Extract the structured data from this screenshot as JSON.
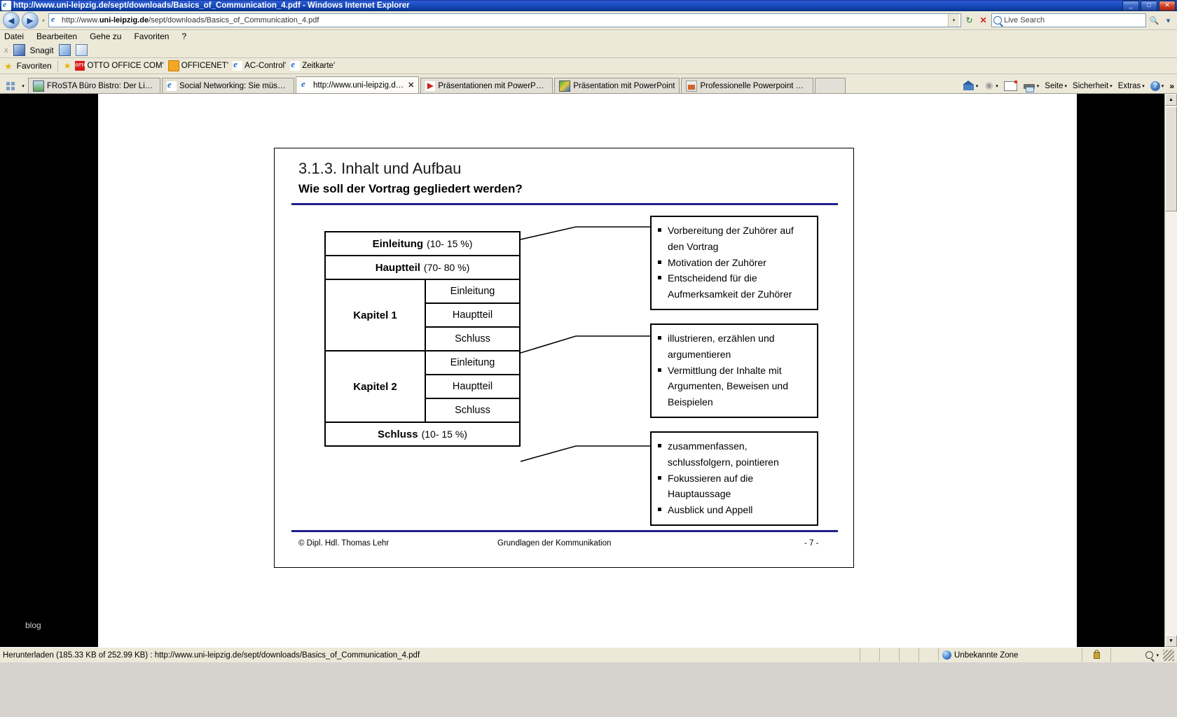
{
  "window": {
    "title": "http://www.uni-leipzig.de/sept/downloads/Basics_of_Communication_4.pdf - Windows Internet Explorer",
    "minimize_label": "_",
    "maximize_label": "□",
    "close_label": "✕",
    "app_icon": "ie-icon"
  },
  "address_bar": {
    "back_label": "◀",
    "forward_label": "▶",
    "history_caret": "▾",
    "url_prefix": "http://www.",
    "url_host": "uni-leipzig.de",
    "url_suffix": "/sept/downloads/Basics_of_Communication_4.pdf",
    "url_full": "http://www.uni-leipzig.de/sept/downloads/Basics_of_Communication_4.pdf",
    "dropdown_label": "▾",
    "refresh_label": "↻",
    "stop_label": "✕",
    "search_placeholder": "Live Search",
    "search_go_label": "🔍",
    "search_caret": "▾"
  },
  "menu": {
    "items": [
      "Datei",
      "Bearbeiten",
      "Gehe zu",
      "Favoriten",
      "?"
    ]
  },
  "snagit_toolbar": {
    "close_label": "x",
    "app_label": "Snagit"
  },
  "favorites_bar": {
    "label": "Favoriten",
    "items": [
      {
        "label": "OTTO OFFICE COM'",
        "icon": "otto-icon"
      },
      {
        "label": "OFFICENET'",
        "icon": "officenet-icon"
      },
      {
        "label": "AC-Control'",
        "icon": "ie-icon"
      },
      {
        "label": "Zeitkarte'",
        "icon": "ie-icon"
      }
    ]
  },
  "tabs": [
    {
      "label": "FRoSTA Büro Bistro: Der Lief…",
      "icon": "frosta-icon",
      "active": false
    },
    {
      "label": "Social Networking: Sie müsse…",
      "icon": "ie-icon",
      "active": false
    },
    {
      "label": "http://www.uni-leipzig.d…",
      "icon": "ie-icon",
      "active": true,
      "close_label": "✕"
    },
    {
      "label": "Präsentationen mit PowerPoi…",
      "icon": "play-icon",
      "active": false
    },
    {
      "label": "Präsentation mit PowerPoint",
      "icon": "colorful-icon",
      "active": false
    },
    {
      "label": "Professionelle Powerpoint Pr…",
      "icon": "powerpoint-icon",
      "active": false
    }
  ],
  "tab_tools": {
    "home_label": "",
    "home_caret": "▾",
    "feeds_label": "",
    "feeds_caret": "▾",
    "mail_label": "",
    "print_label": "",
    "print_caret": "▾",
    "page_label": "Seite",
    "page_caret": "▾",
    "security_label": "Sicherheit",
    "security_caret": "▾",
    "extras_label": "Extras",
    "extras_caret": "▾",
    "help_caret": "▾",
    "overflow_label": "»"
  },
  "left_pane": {
    "blog_label": "blog"
  },
  "scrollbar": {
    "up_label": "▲",
    "down_label": "▼"
  },
  "slide": {
    "title": "3.1.3. Inhalt und Aufbau",
    "subtitle": "Wie soll der Vortrag gegliedert werden?",
    "rule_color": "#1f1f8f",
    "footer": {
      "left": "© Dipl. Hdl. Thomas Lehr",
      "middle": "Grundlagen der Kommunikation",
      "right": "- 7 -"
    },
    "structure": {
      "intro": {
        "label": "Einleitung",
        "percent": "(10- 15 %)"
      },
      "main": {
        "label": "Hauptteil",
        "percent": "(70- 80 %)"
      },
      "chapters": [
        {
          "label": "Kapitel 1",
          "parts": [
            "Einleitung",
            "Hauptteil",
            "Schluss"
          ]
        },
        {
          "label": "Kapitel 2",
          "parts": [
            "Einleitung",
            "Hauptteil",
            "Schluss"
          ]
        }
      ],
      "conclusion": {
        "label": "Schluss",
        "percent": "(10- 15 %)"
      }
    },
    "callouts": [
      {
        "items": [
          "Vorbereitung der Zuhörer auf den Vortrag",
          "Motivation der Zuhörer",
          "Entscheidend für die Aufmerksamkeit der Zuhörer"
        ]
      },
      {
        "items": [
          "illustrieren, erzählen und argumentieren",
          "Vermittlung der Inhalte mit Argumenten, Beweisen und Beispielen"
        ]
      },
      {
        "items": [
          "zusammenfassen, schlussfolgern, pointieren",
          "Fokussieren auf die Hauptaussage",
          "Ausblick und Appell"
        ]
      }
    ]
  },
  "status_bar": {
    "text": "Herunterladen (185.33 KB of 252.99 KB) : http://www.uni-leipzig.de/sept/downloads/Basics_of_Communication_4.pdf",
    "zone": "Unbekannte Zone",
    "zoom_caret": "▾"
  }
}
